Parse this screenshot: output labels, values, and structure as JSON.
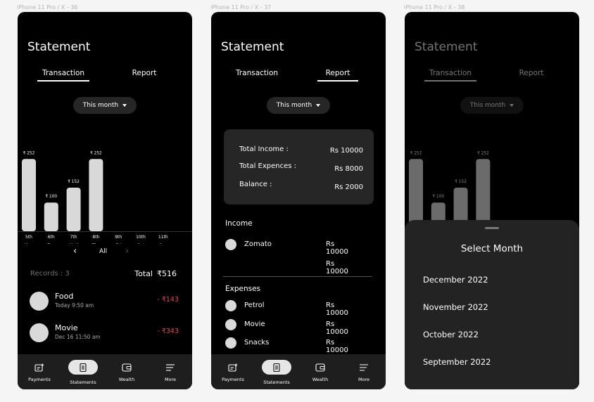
{
  "frames": [
    {
      "label": "iPhone 11 Pro / X - 36"
    },
    {
      "label": "iPhone 11 Pro / X - 37"
    },
    {
      "label": "iPhone 11 Pro / X - 38"
    }
  ],
  "common": {
    "title": "Statement",
    "tabs": [
      "Transaction",
      "Report"
    ],
    "filter": "This month"
  },
  "chart_data": {
    "type": "bar",
    "categories": [
      "5th",
      "6th",
      "7th",
      "8th",
      "9th",
      "10th",
      "11th"
    ],
    "days": [
      "Mon",
      "Tue",
      "Wed",
      "Thu",
      "Fri",
      "Sat",
      "Sun"
    ],
    "values": [
      252,
      100,
      152,
      252,
      0,
      0,
      0
    ],
    "value_labels": [
      "₹ 252",
      "₹ 100",
      "₹ 152",
      "₹ 252",
      "",
      "",
      ""
    ],
    "ylim": [
      0,
      260
    ]
  },
  "pager": {
    "label": "All"
  },
  "records": {
    "count_label": "Records : 3",
    "total_label": "Total",
    "total_value": "₹516"
  },
  "transactions": [
    {
      "name": "Food",
      "time": "Today 9:50 am",
      "amount": "- ₹143"
    },
    {
      "name": "Movie",
      "time": "Dec 16 11:50 am",
      "amount": "- ₹343"
    }
  ],
  "nav": [
    {
      "label": "Payments",
      "icon": "payments-icon"
    },
    {
      "label": "Statements",
      "icon": "statements-icon"
    },
    {
      "label": "Wealth",
      "icon": "wallet-icon"
    },
    {
      "label": "More",
      "icon": "menu-icon"
    }
  ],
  "report": {
    "summary": [
      {
        "label": "Total Income :",
        "value": "Rs 10000"
      },
      {
        "label": "Total Expences :",
        "value": "Rs 8000"
      },
      {
        "label": "Balance :",
        "value": "Rs 2000"
      }
    ],
    "income_title": "Income",
    "income": [
      {
        "name": "Zomato",
        "value": "Rs 10000"
      },
      {
        "name": "",
        "value": "Rs 10000"
      }
    ],
    "expenses_title": "Expenses",
    "expenses": [
      {
        "name": "Petrol",
        "value": "Rs 10000"
      },
      {
        "name": "Movie",
        "value": "Rs 10000"
      },
      {
        "name": "Snacks",
        "value": "Rs 10000"
      }
    ]
  },
  "month_picker": {
    "title": "Select Month",
    "months": [
      "December 2022",
      "November 2022",
      "October 2022",
      "September 2022"
    ]
  },
  "colors": {
    "accent_negative": "#e24b4b",
    "bar": "#d9d9d9",
    "bar_dim": "#6b6b6b"
  }
}
